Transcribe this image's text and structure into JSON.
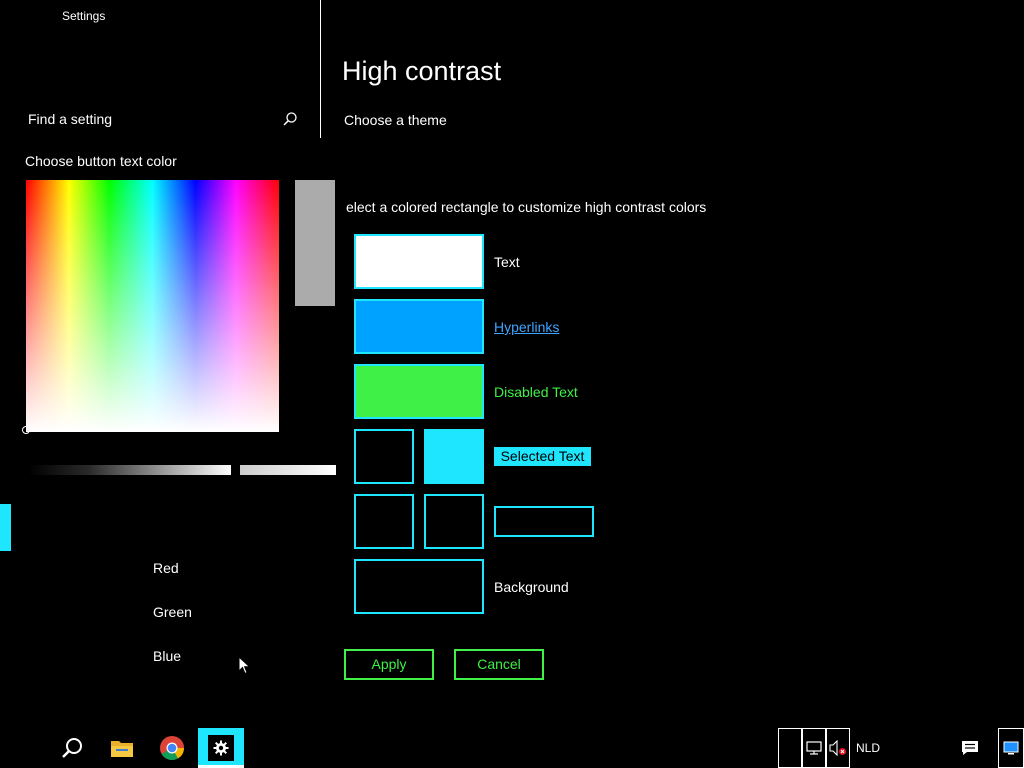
{
  "window": {
    "title": "Settings"
  },
  "sidebar": {
    "search_placeholder": "Find a setting"
  },
  "main": {
    "title": "High contrast",
    "theme_label": "Choose a theme",
    "instructions": "elect a colored rectangle to customize high contrast colors",
    "swatches": {
      "text_label": "Text",
      "hyperlinks_label": "Hyperlinks",
      "disabled_label": "Disabled Text",
      "selected_label": "Selected Text",
      "background_label": "Background"
    },
    "buttons": {
      "apply": "Apply",
      "cancel": "Cancel"
    }
  },
  "color_picker": {
    "title": "Choose button text color",
    "labels": {
      "red": "Red",
      "green": "Green",
      "blue": "Blue"
    }
  },
  "colors": {
    "text": "#ffffff",
    "hyperlink": "#00a2ff",
    "disabled": "#3ff046",
    "selected_bg": "#1ee6ff",
    "border": "#1ee6ff",
    "preview": "#ababab"
  },
  "taskbar": {
    "icons": [
      "search-icon",
      "file-explorer-icon",
      "chrome-icon",
      "settings-icon"
    ],
    "tray": {
      "language": "NLD"
    }
  }
}
